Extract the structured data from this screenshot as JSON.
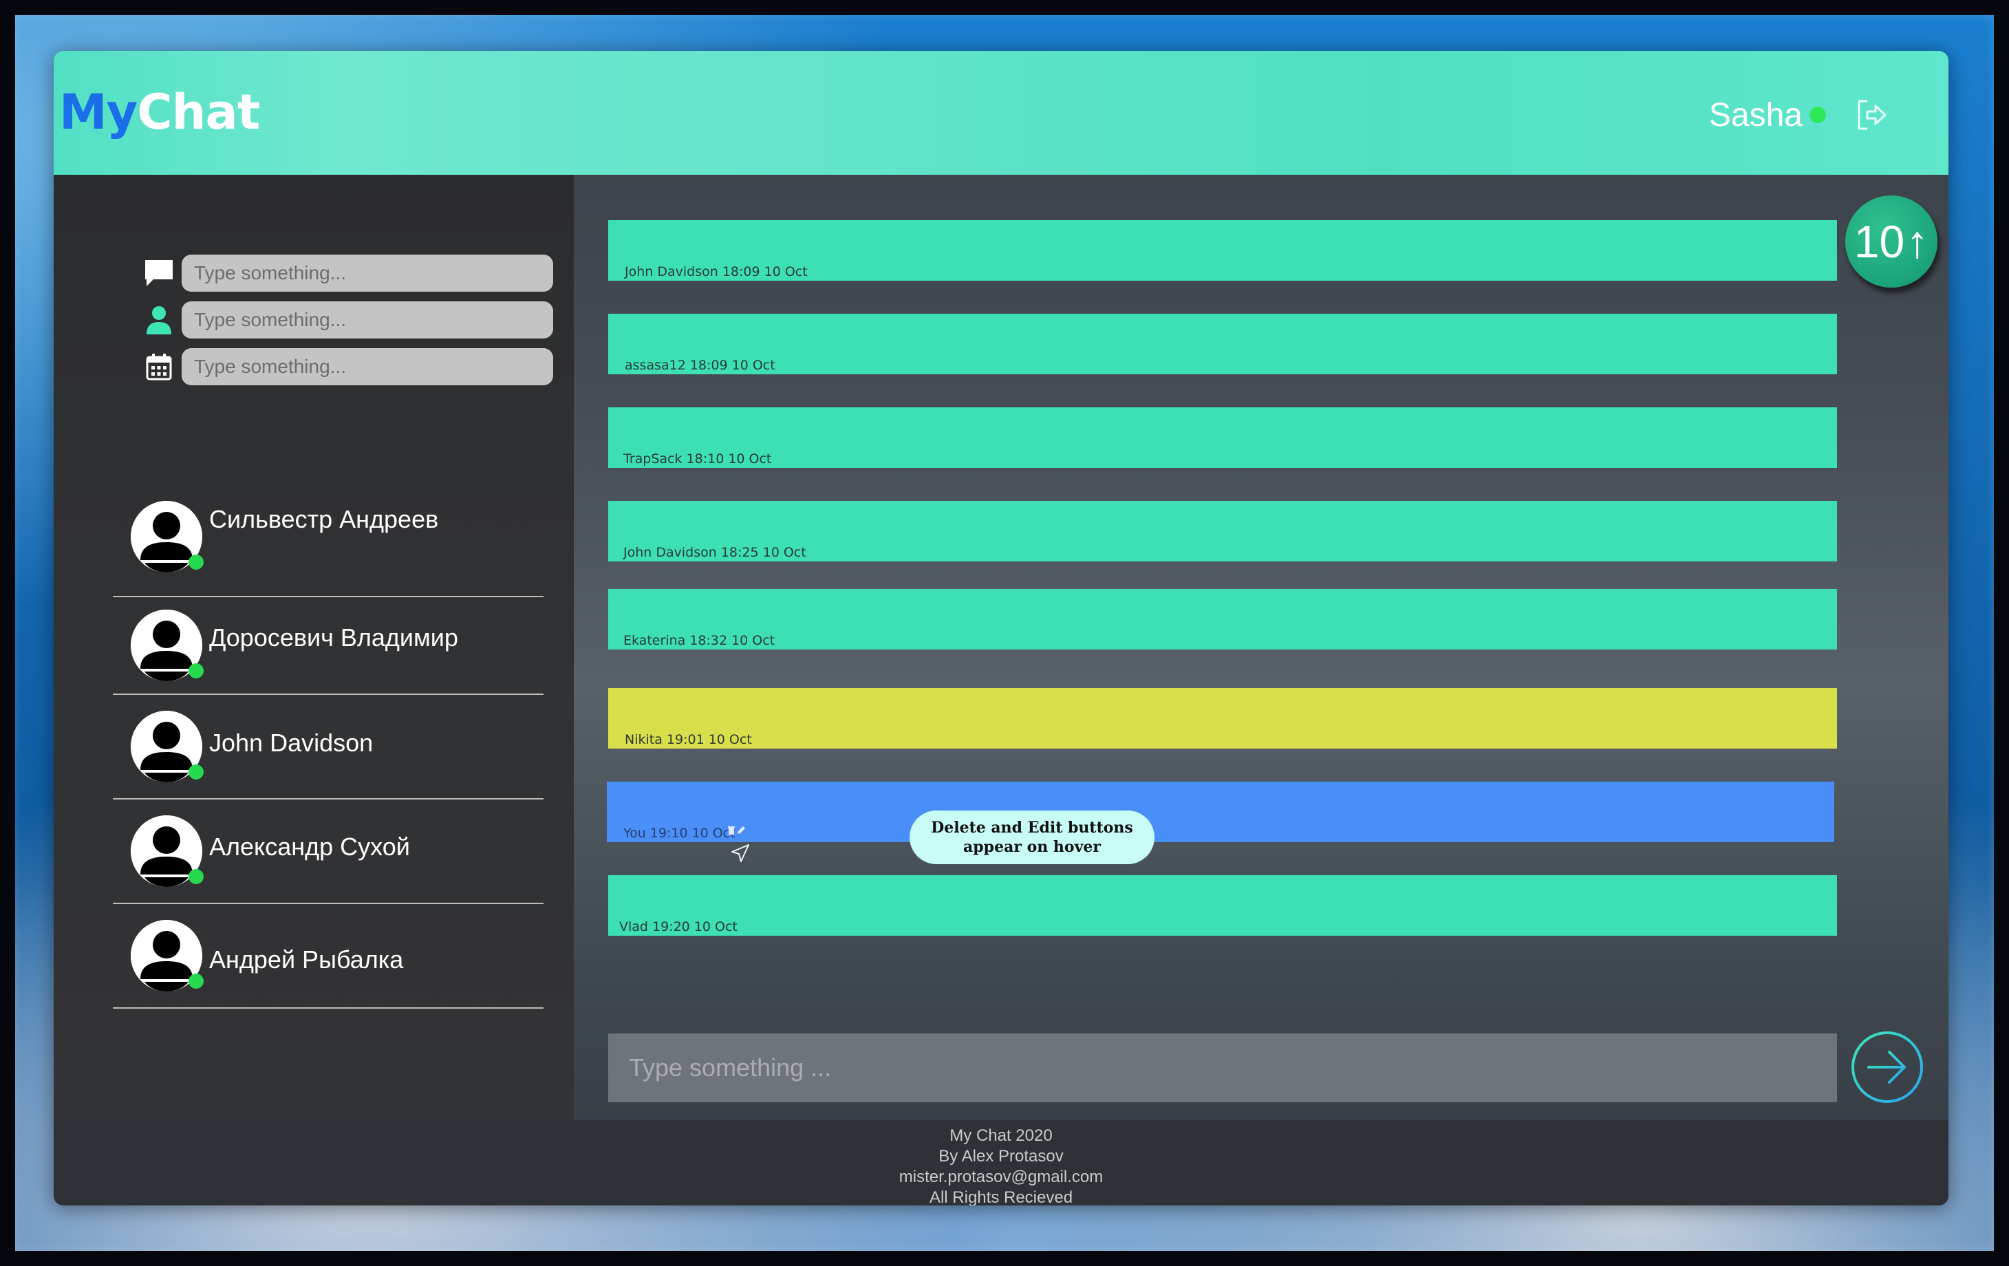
{
  "header": {
    "logo_my": "My",
    "logo_chat": "Chat",
    "username": "Sasha"
  },
  "sidebar": {
    "search_fields": [
      {
        "icon": "chat-bubble-icon",
        "placeholder": "Type something..."
      },
      {
        "icon": "user-icon",
        "placeholder": "Type something..."
      },
      {
        "icon": "calendar-icon",
        "placeholder": "Type something..."
      }
    ],
    "contacts": [
      {
        "name": "Сильвестр Андреев",
        "online": true
      },
      {
        "name": "Доросевич Владимир",
        "online": true
      },
      {
        "name": "John Davidson",
        "online": true
      },
      {
        "name": "Александр Сухой",
        "online": true
      },
      {
        "name": "Андрей Рыбалка",
        "online": true
      }
    ]
  },
  "messages": [
    {
      "meta": "John Davidson 18:09 10 Oct",
      "style": "normal"
    },
    {
      "meta": "assasa12 18:09 10 Oct",
      "style": "normal"
    },
    {
      "meta": "TrapSack 18:10 10 Oct",
      "style": "normal"
    },
    {
      "meta": "John Davidson 18:25 10 Oct",
      "style": "normal"
    },
    {
      "meta": "Ekaterina 18:32 10 Oct",
      "style": "normal"
    },
    {
      "meta": "Nikita 19:01 10 Oct",
      "style": "highlight"
    },
    {
      "meta": "You 19:10 10 Oct",
      "style": "own"
    },
    {
      "meta": "Vlad 19:20 10 Oct",
      "style": "normal"
    }
  ],
  "tooltip": "Delete and Edit buttons appear on hover",
  "unread_badge": {
    "count": "10",
    "arrow": "↑"
  },
  "composer": {
    "placeholder": "Type something ..."
  },
  "footer": {
    "line1": "My Chat 2020",
    "line2": "By Alex Protasov",
    "line3": "mister.protasov@gmail.com",
    "line4": "All Rights Recieved"
  },
  "colors": {
    "header_accent": "#52e0c4",
    "message_bg": "#3de0b3",
    "highlight_bg": "#d8df4a",
    "own_bg": "#4a8ef8",
    "online": "#27d94e"
  }
}
